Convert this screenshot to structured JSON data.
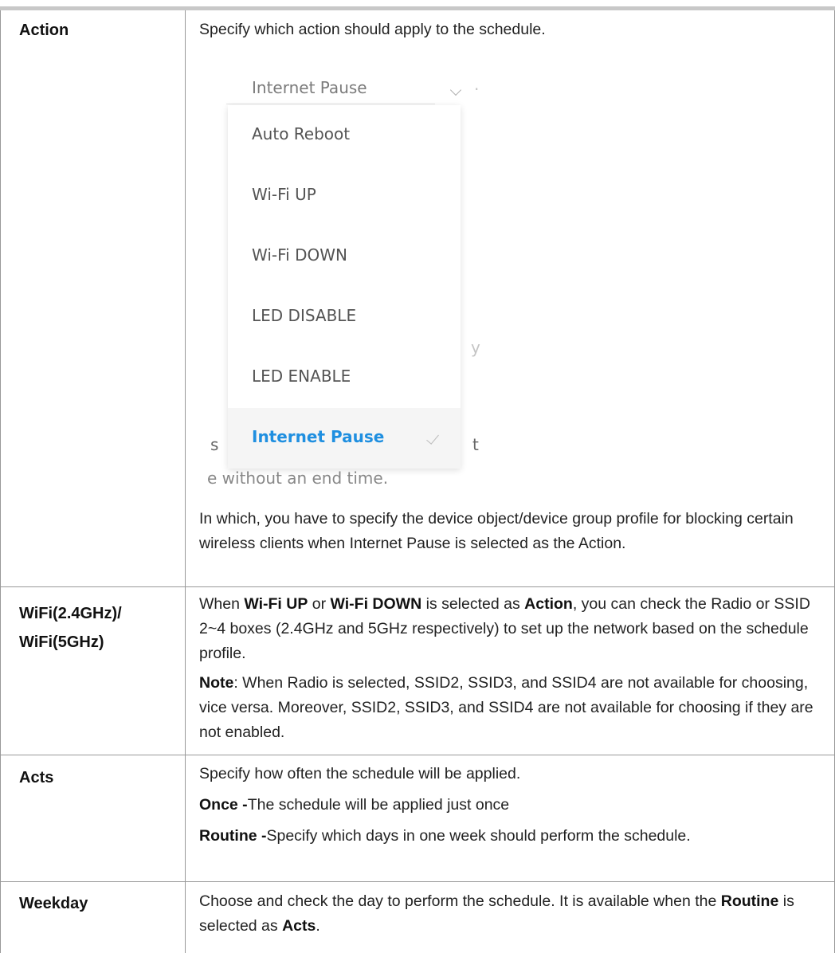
{
  "rows": [
    {
      "param": "Action",
      "desc_intro": "Specify which action should apply to the schedule.",
      "dropdown": {
        "selected_value": "Internet Pause",
        "options": [
          "Auto Reboot",
          "Wi-Fi UP",
          "Wi-Fi DOWN",
          "LED DISABLE",
          "LED ENABLE",
          "Internet Pause"
        ],
        "selected_color": "#1f8fe0"
      },
      "desc_after": "In which, you have to specify the device object/device group profile for blocking certain wireless clients when Internet Pause is selected as the Action."
    },
    {
      "param_line1": "WiFi(2.4GHz)/",
      "param_line2": "WiFi(5GHz)",
      "p1": {
        "t1": "When ",
        "b1": "Wi-Fi UP",
        "t2": " or ",
        "b2": "Wi-Fi DOWN",
        "t3": " is selected as ",
        "b3": "Action",
        "t4": ", you can check the Radio or SSID 2~4 boxes (2.4GHz and 5GHz respectively) to set up the network based on the schedule profile."
      },
      "p2": {
        "b1": "Note",
        "t1": ": When Radio is selected, SSID2, SSID3, and SSID4 are not available for choosing, vice versa. Moreover, SSID2, SSID3, and SSID4 are not available for choosing if they are not enabled."
      }
    },
    {
      "param": "Acts",
      "p1": "Specify how often the schedule will be applied.",
      "p2": {
        "b1": "Once -",
        "t1": "The schedule will be applied just once"
      },
      "p3": {
        "b1": "Routine -",
        "t1": "Specify which days in one week should perform the schedule."
      }
    },
    {
      "param": "Weekday",
      "p1": {
        "t1": "Choose and check the day to perform the schedule. It is available when the ",
        "b1": "Routine",
        "t2": " is selected as ",
        "b2": "Acts",
        "t3": "."
      }
    }
  ]
}
